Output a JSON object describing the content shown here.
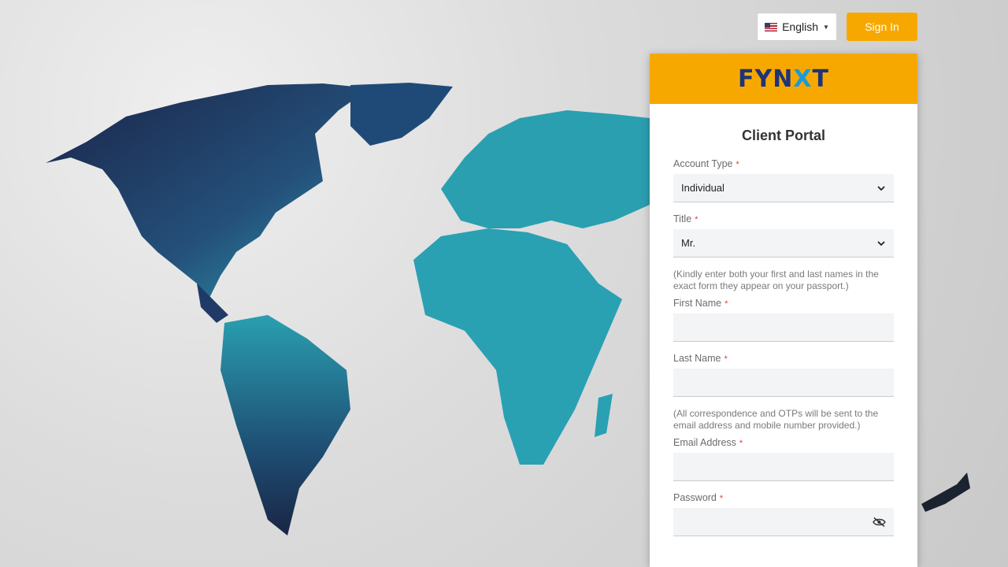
{
  "header": {
    "language_label": "English",
    "signin_label": "Sign In"
  },
  "panel": {
    "logo_prefix": "FYN",
    "logo_x": "X",
    "logo_suffix": "T",
    "title": "Client Portal",
    "account_type": {
      "label": "Account Type",
      "value": "Individual"
    },
    "title_field": {
      "label": "Title",
      "value": "Mr."
    },
    "name_hint": "(Kindly enter both your first and last names in the exact form they appear on your passport.)",
    "first_name": {
      "label": "First Name",
      "value": ""
    },
    "last_name": {
      "label": "Last Name",
      "value": ""
    },
    "email_hint": "(All correspondence and OTPs will be sent to the email address and mobile number provided.)",
    "email": {
      "label": "Email Address",
      "value": ""
    },
    "password": {
      "label": "Password",
      "value": ""
    },
    "required_mark": "*"
  },
  "colors": {
    "accent": "#f7a800",
    "logo_navy": "#1d3478",
    "map_teal": "#2a9fb0",
    "map_navy": "#1f2e5a",
    "required": "#e53935"
  },
  "icons": {
    "language_flag": "us-flag-icon",
    "dropdown": "chevron-down-icon",
    "password_toggle": "eye-off-icon"
  }
}
